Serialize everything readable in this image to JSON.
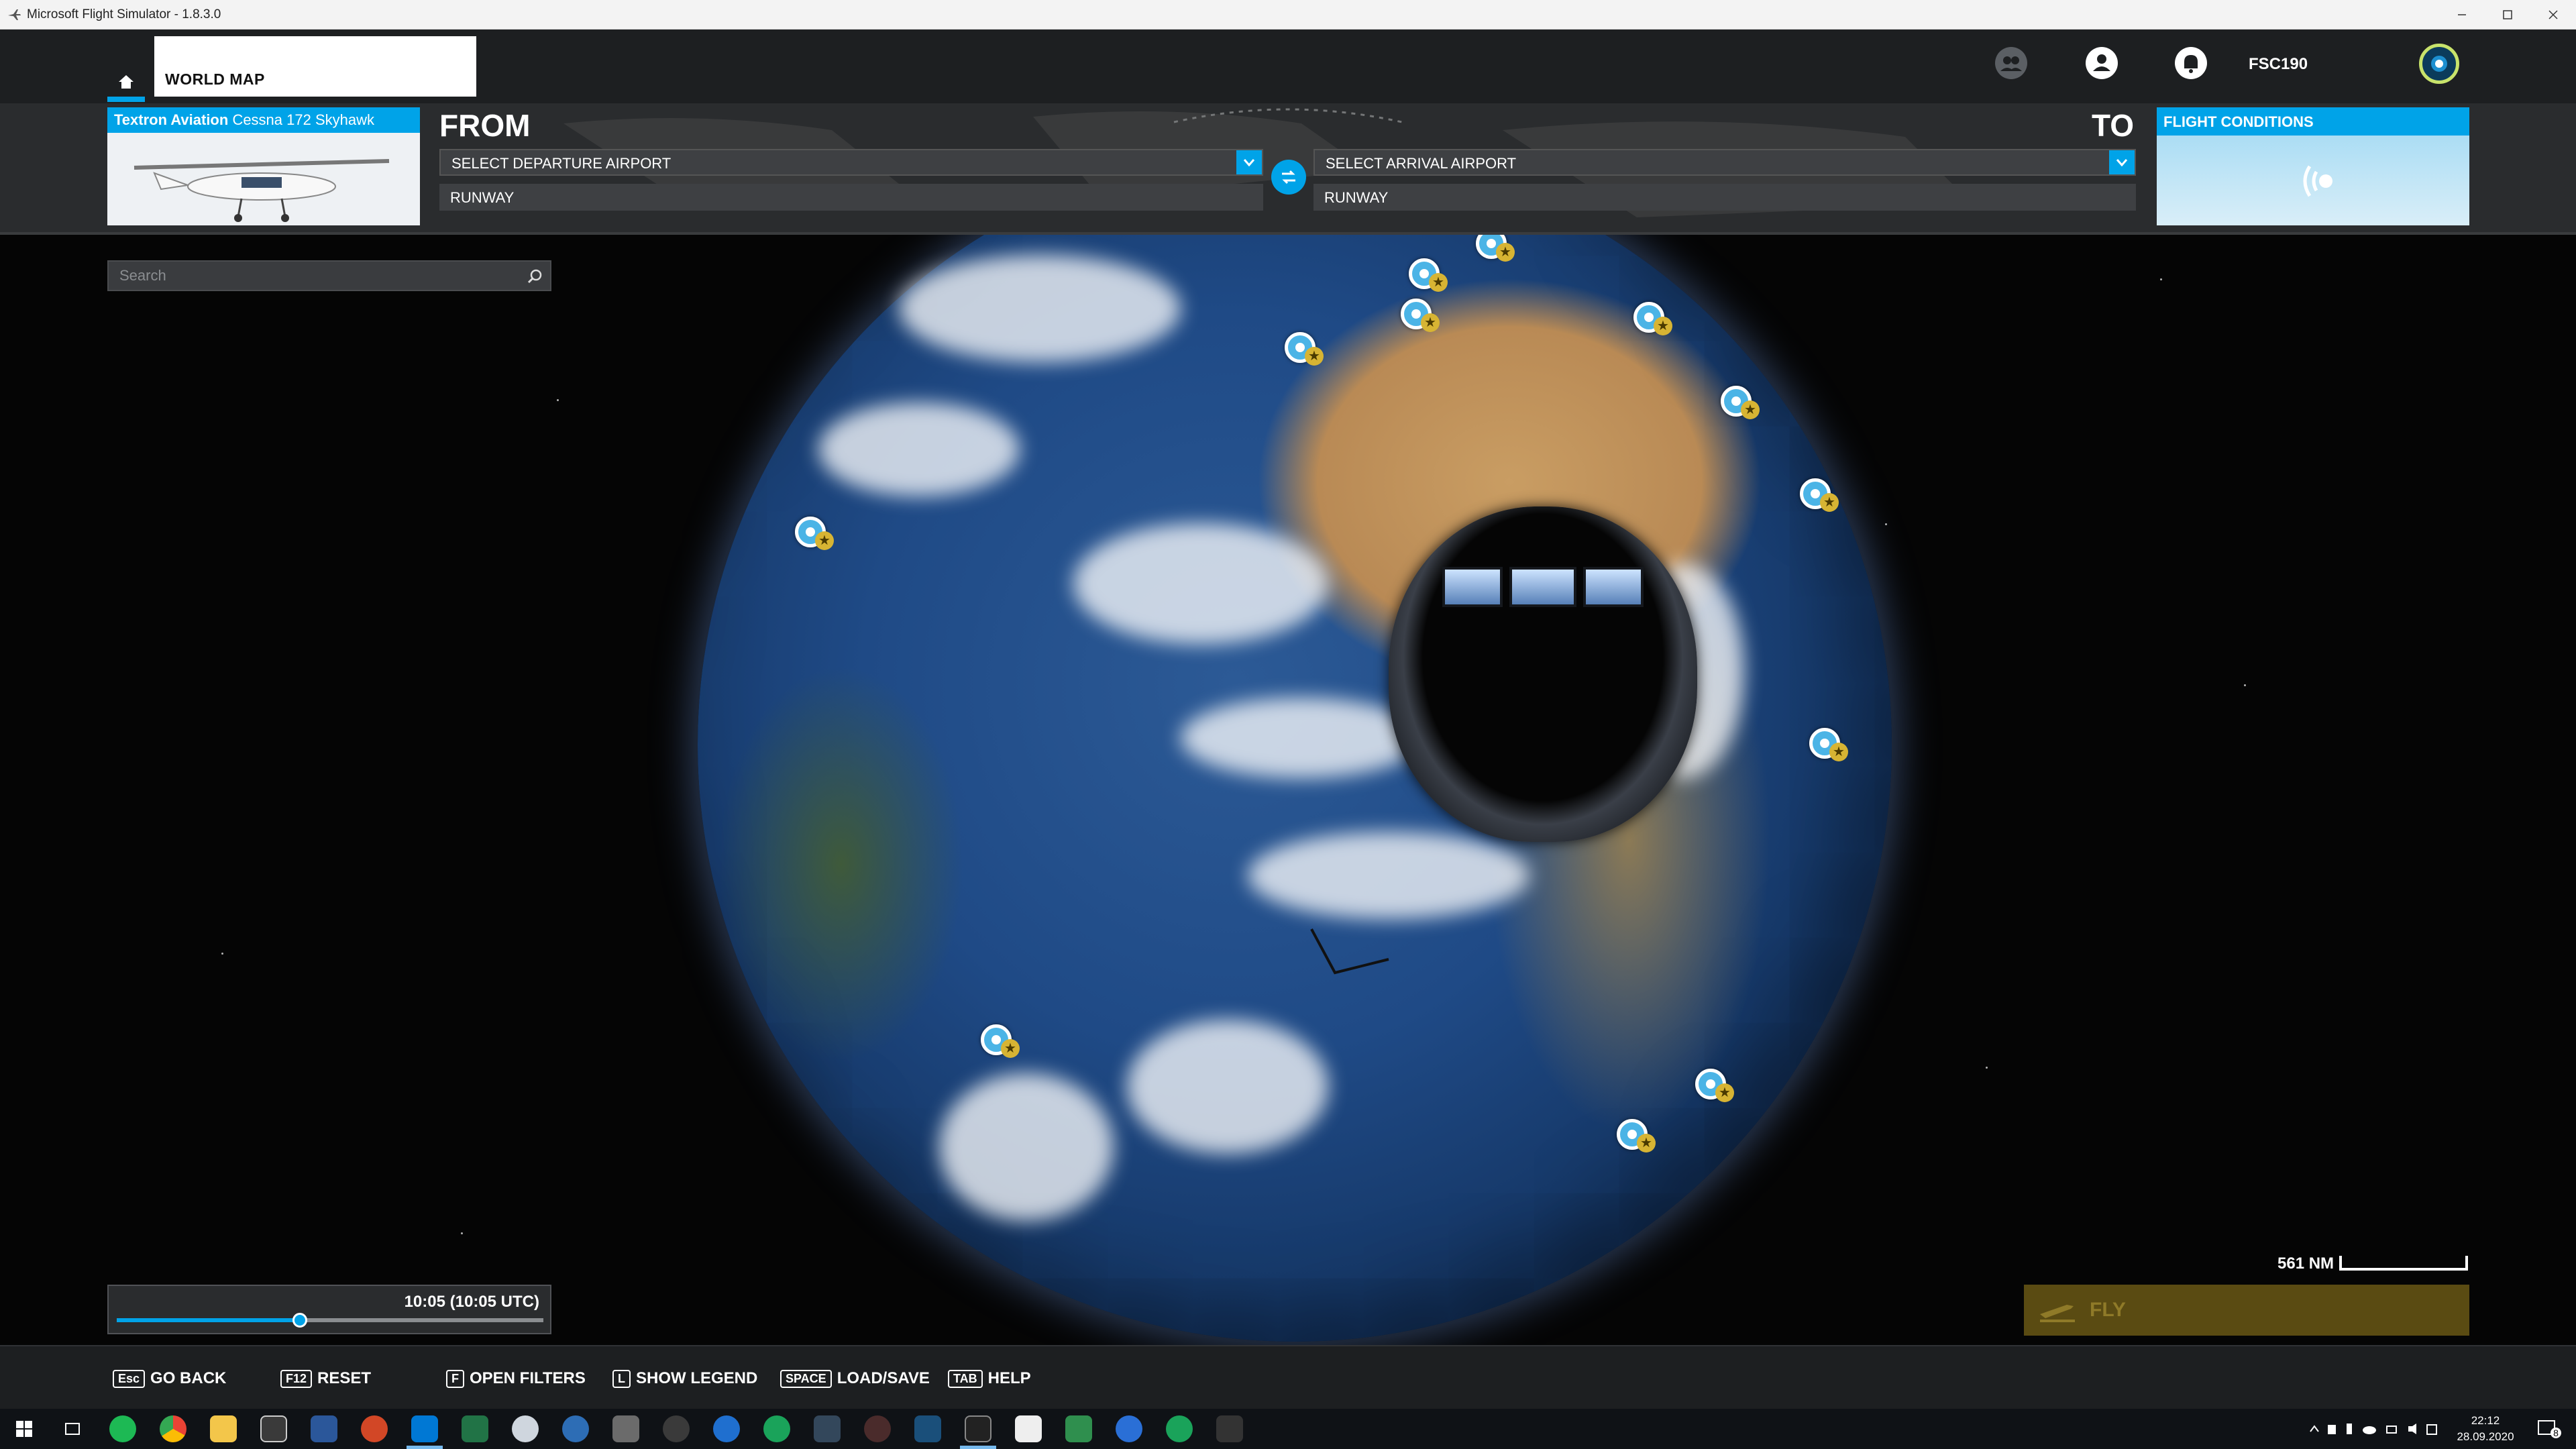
{
  "window": {
    "title": "Microsoft Flight Simulator - 1.8.3.0"
  },
  "topbar": {
    "tab_label": "WORLD MAP",
    "username": "FSC190"
  },
  "planner": {
    "aircraft_brand": "Textron Aviation",
    "aircraft_model": "Cessna 172 Skyhawk",
    "from_label": "FROM",
    "to_label": "TO",
    "departure_placeholder": "SELECT DEPARTURE AIRPORT",
    "arrival_placeholder": "SELECT ARRIVAL AIRPORT",
    "departure_runway": "RUNWAY",
    "arrival_runway": "RUNWAY",
    "conditions_title": "FLIGHT CONDITIONS"
  },
  "map": {
    "search_placeholder": "Search",
    "time_label": "10:05 (10:05 UTC)",
    "time_progress": 0.43,
    "scale_label": "561 NM",
    "fly_label": "FLY"
  },
  "commands": [
    {
      "key": "Esc",
      "label": "GO BACK"
    },
    {
      "key": "F12",
      "label": "RESET"
    },
    {
      "key": "F",
      "label": "OPEN FILTERS"
    },
    {
      "key": "L",
      "label": "SHOW LEGEND"
    },
    {
      "key": "SPACE",
      "label": "LOAD/SAVE"
    },
    {
      "key": "TAB",
      "label": "HELP"
    }
  ],
  "taskbar": {
    "time": "22:12",
    "date": "28.09.2020",
    "notification_count": "8"
  },
  "colors": {
    "accent": "#00a3e8",
    "fly_disabled": "#5a4b12",
    "chrome_dark": "#1d1f21"
  }
}
